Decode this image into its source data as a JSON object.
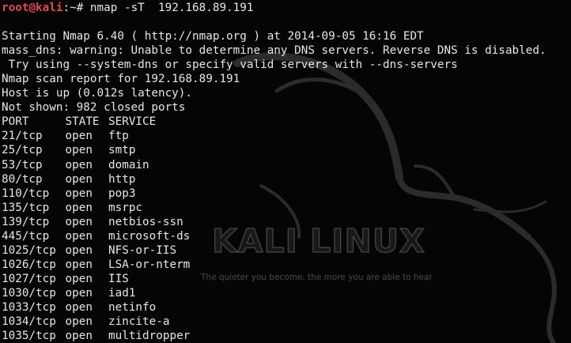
{
  "prompt": {
    "user": "root",
    "at": "@",
    "host": "kali",
    "path_symbol": ":~# ",
    "command": "nmap -sT  192.168.89.191"
  },
  "output_lines": [
    "Starting Nmap 6.40 ( http://nmap.org ) at 2014-09-05 16:16 EDT",
    "mass_dns: warning: Unable to determine any DNS servers. Reverse DNS is disabled.",
    " Try using --system-dns or specify valid servers with --dns-servers",
    "Nmap scan report for 192.168.89.191",
    "Host is up (0.012s latency).",
    "Not shown: 982 closed ports"
  ],
  "table": {
    "headers": {
      "port": "PORT",
      "state": "STATE",
      "service": "SERVICE"
    },
    "rows": [
      {
        "port": "21/tcp",
        "state": "open",
        "service": "ftp"
      },
      {
        "port": "25/tcp",
        "state": "open",
        "service": "smtp"
      },
      {
        "port": "53/tcp",
        "state": "open",
        "service": "domain"
      },
      {
        "port": "80/tcp",
        "state": "open",
        "service": "http"
      },
      {
        "port": "110/tcp",
        "state": "open",
        "service": "pop3"
      },
      {
        "port": "135/tcp",
        "state": "open",
        "service": "msrpc"
      },
      {
        "port": "139/tcp",
        "state": "open",
        "service": "netbios-ssn"
      },
      {
        "port": "445/tcp",
        "state": "open",
        "service": "microsoft-ds"
      },
      {
        "port": "1025/tcp",
        "state": "open",
        "service": "NFS-or-IIS"
      },
      {
        "port": "1026/tcp",
        "state": "open",
        "service": "LSA-or-nterm"
      },
      {
        "port": "1027/tcp",
        "state": "open",
        "service": "IIS"
      },
      {
        "port": "1030/tcp",
        "state": "open",
        "service": "iad1"
      },
      {
        "port": "1033/tcp",
        "state": "open",
        "service": "netinfo"
      },
      {
        "port": "1034/tcp",
        "state": "open",
        "service": "zincite-a"
      },
      {
        "port": "1035/tcp",
        "state": "open",
        "service": "multidropper"
      }
    ]
  },
  "wallpaper": {
    "brand": "KALI LINUX",
    "tagline": "The quieter you become, the more you are able to hear",
    "icon": "kali-dragon-logo-icon"
  },
  "colors": {
    "background": "#050505",
    "text": "#e6e6e6",
    "prompt": "#e14a4a",
    "wallpaper_art": "#2b2b2b"
  }
}
